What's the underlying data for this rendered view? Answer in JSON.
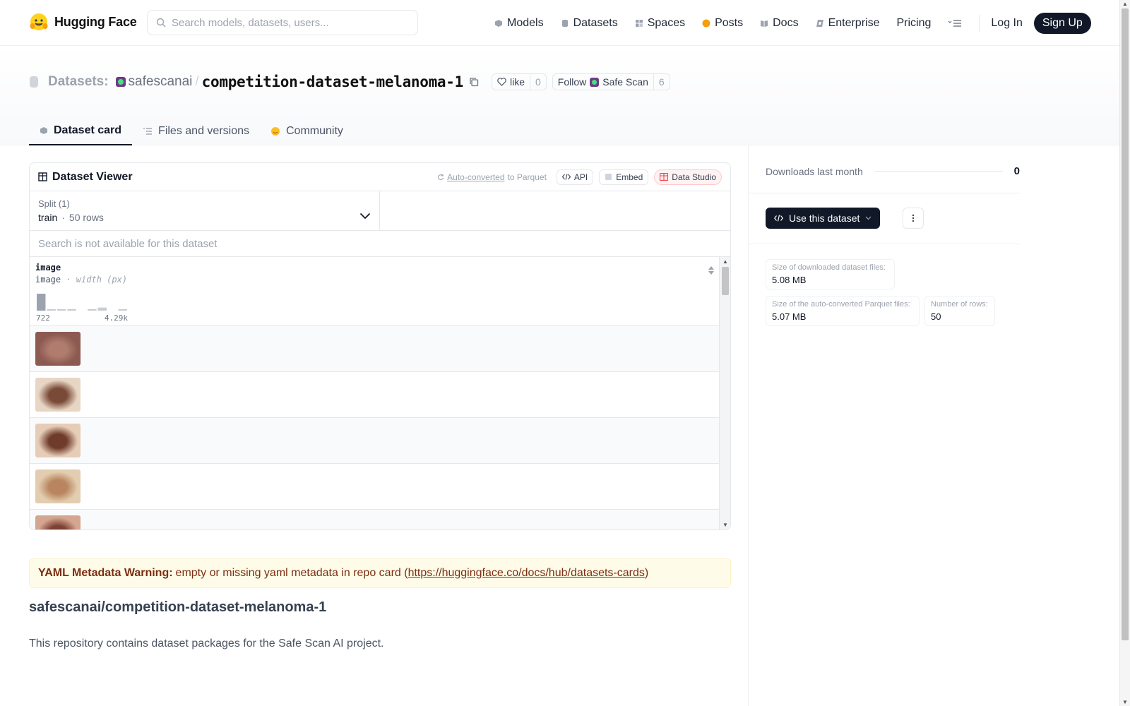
{
  "header": {
    "brand": "Hugging Face",
    "search_placeholder": "Search models, datasets, users...",
    "nav": [
      "Models",
      "Datasets",
      "Spaces",
      "Posts",
      "Docs",
      "Enterprise",
      "Pricing"
    ],
    "login": "Log In",
    "signup": "Sign Up"
  },
  "title": {
    "section": "Datasets:",
    "owner": "safescanai",
    "separator": "/",
    "repo": "competition-dataset-melanoma-1",
    "like_label": "like",
    "like_count": "0",
    "follow_label": "Follow",
    "follow_org": "Safe Scan",
    "follow_count": "6"
  },
  "tabs": [
    "Dataset card",
    "Files and versions",
    "Community"
  ],
  "viewer": {
    "title": "Dataset Viewer",
    "auto_converted": "Auto-converted",
    "to_parquet": "to Parquet",
    "api": "API",
    "embed": "Embed",
    "data_studio": "Data Studio",
    "split_label": "Split (1)",
    "split_name": "train",
    "split_sep": "·",
    "split_rows": "50 rows",
    "search_na": "Search is not available for this dataset",
    "column_name": "image",
    "column_type": "image",
    "column_detail": "· width (px)",
    "histogram": {
      "min_label": "722",
      "max_label": "4.29k",
      "bins": [
        22,
        2,
        2,
        2,
        0,
        2,
        4,
        0,
        2
      ]
    },
    "thumb_colors": [
      [
        "#8d5a52",
        "#b07c6e"
      ],
      [
        "#e8d6c4",
        "#7a4a38"
      ],
      [
        "#e6cdb8",
        "#6f3b2a"
      ],
      [
        "#e3cdb0",
        "#b98560"
      ],
      [
        "#d4a58f",
        "#7d4034"
      ]
    ]
  },
  "warning": {
    "label": "YAML Metadata Warning:",
    "text": "empty or missing yaml metadata in repo card (",
    "link": "https://huggingface.co/docs/hub/datasets-cards",
    "close": ")"
  },
  "card": {
    "title": "safescanai/competition-dataset-melanoma-1",
    "description": "This repository contains dataset packages for the Safe Scan AI project."
  },
  "sidebar": {
    "downloads_label": "Downloads last month",
    "downloads_value": "0",
    "use_dataset": "Use this dataset",
    "stats": [
      {
        "label": "Size of downloaded dataset files:",
        "value": "5.08 MB"
      },
      {
        "label": "Size of the auto-converted Parquet files:",
        "value": "5.07 MB"
      },
      {
        "label": "Number of rows:",
        "value": "50"
      }
    ]
  },
  "colors": {
    "primary_dark": "#111827",
    "posts_dot": "#f59e0b",
    "studio_red": "#ef4444",
    "warning_bg": "#fefce8"
  }
}
